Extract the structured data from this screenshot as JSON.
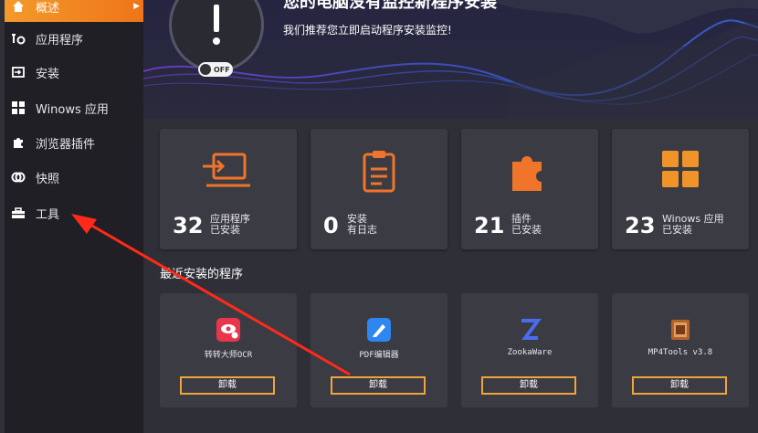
{
  "sidebar": {
    "items": [
      {
        "label": "概述",
        "icon": "home-icon",
        "active": true
      },
      {
        "label": "应用程序",
        "icon": "apps-icon"
      },
      {
        "label": "安装",
        "icon": "install-icon"
      },
      {
        "label": "Winows 应用",
        "icon": "windows-grid-icon"
      },
      {
        "label": "浏览器插件",
        "icon": "puzzle-icon"
      },
      {
        "label": "快照",
        "icon": "snapshot-icon"
      },
      {
        "label": "工具",
        "icon": "toolbox-icon"
      }
    ]
  },
  "hero": {
    "title": "您的电脑没有监控新程序安装",
    "subtitle": "我们推荐您立即启动程序安装监控!",
    "toggle_label": "OFF"
  },
  "stats": [
    {
      "num": "32",
      "line1": "应用程序",
      "line2": "已安装",
      "icon": "monitor-arrow-icon"
    },
    {
      "num": "0",
      "line1": "安装",
      "line2": "有日志",
      "icon": "clipboard-icon"
    },
    {
      "num": "21",
      "line1": "插件",
      "line2": "已安装",
      "icon": "puzzle-icon"
    },
    {
      "num": "23",
      "line1": "Winows 应用",
      "line2": "已安装",
      "icon": "windows-grid-icon"
    }
  ],
  "recent": {
    "title": "最近安装的程序",
    "apps": [
      {
        "name": "转转大师OCR",
        "button": "卸载",
        "icon": "eye-ocr-icon",
        "color": "#e8364a"
      },
      {
        "name": "PDF编辑器",
        "button": "卸载",
        "icon": "pdf-pen-icon",
        "color": "#2f86f0"
      },
      {
        "name": "ZookaWare",
        "button": "卸载",
        "icon": "z-logo-icon",
        "color": "#4b6cf0"
      },
      {
        "name": "MP4Tools v3.8",
        "button": "卸载",
        "icon": "mp4tools-icon",
        "color": "#b3622a"
      }
    ]
  },
  "colors": {
    "accent": "#f0741a",
    "accent_outline": "#f0a43a",
    "arrow": "#ff2a1a"
  }
}
